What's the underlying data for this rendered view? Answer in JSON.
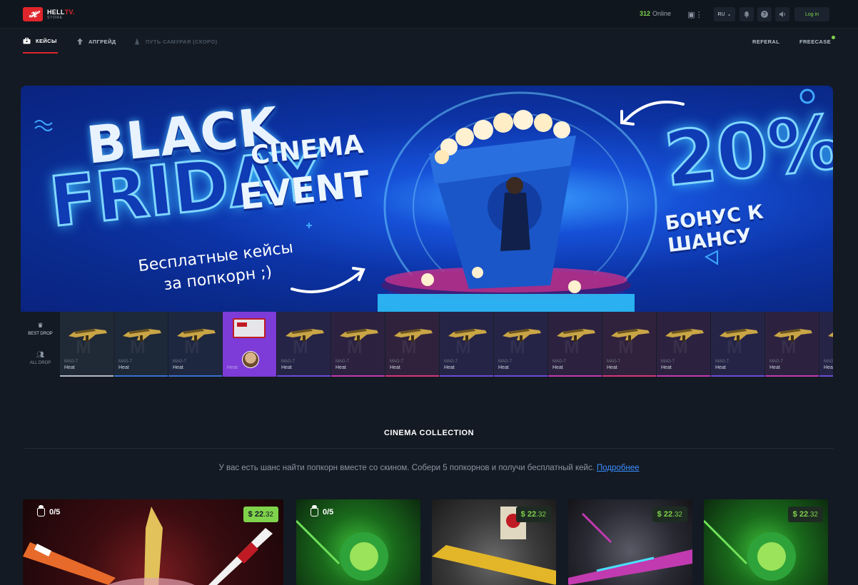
{
  "header": {
    "logo_mark": "𝓗",
    "logo_main_a": "HELL",
    "logo_main_b": "TV.",
    "logo_sub": "STORE",
    "online_count": "312",
    "online_label": "Online",
    "lang": "RU",
    "login_label": "Log in"
  },
  "nav": {
    "cases": "КЕЙСЫ",
    "upgrade": "АПГРЕЙД",
    "samurai": "ПУТЬ САМУРАЯ (СКОРО)",
    "referal": "REFERAL",
    "freecase": "FREECASE"
  },
  "banner": {
    "black": "BLACK",
    "friday": "FRIDAY",
    "cinema": "CINEMA",
    "event": "EVENT",
    "free_line1": "Бесплатные кейсы",
    "free_line2": "за попкорн ;)",
    "percent": "20%",
    "bonus": "БОНУС К ШАНСУ"
  },
  "drops": {
    "best_label": "BEST DROP",
    "all_label": "ALL DROP",
    "items": [
      {
        "name": "MAG-7",
        "skin": "Heat",
        "color": "#b4b8c0",
        "bg": "#202a36"
      },
      {
        "name": "MAG-7",
        "skin": "Heat",
        "color": "#3b6fd0",
        "bg": "#1d2838"
      },
      {
        "name": "MAG-7",
        "skin": "Heat",
        "color": "#3b6fd0",
        "bg": "#1e2740"
      },
      {
        "name": "",
        "skin": "Heat",
        "color": "#7d3bd8",
        "bg": "#7d3bd8"
      },
      {
        "name": "MAG-7",
        "skin": "Heat",
        "color": "#6b4cd8",
        "bg": "#262446"
      },
      {
        "name": "MAG-7",
        "skin": "Heat",
        "color": "#c23ab0",
        "bg": "#2c2240"
      },
      {
        "name": "MAG-7",
        "skin": "Heat",
        "color": "#d8357a",
        "bg": "#30223c"
      },
      {
        "name": "MAG-7",
        "skin": "Heat",
        "color": "#6b4cd8",
        "bg": "#262446"
      },
      {
        "name": "MAG-7",
        "skin": "Heat",
        "color": "#6b4cd8",
        "bg": "#262446"
      },
      {
        "name": "MAG-7",
        "skin": "Heat",
        "color": "#c23ab0",
        "bg": "#2c2240"
      },
      {
        "name": "MAG-7",
        "skin": "Heat",
        "color": "#d8357a",
        "bg": "#30223c"
      },
      {
        "name": "MAG-7",
        "skin": "Heat",
        "color": "#c23ab0",
        "bg": "#2c2240"
      },
      {
        "name": "MAG-7",
        "skin": "Heat",
        "color": "#6b4cd8",
        "bg": "#262446"
      },
      {
        "name": "MAG-7",
        "skin": "Heat",
        "color": "#c23ab0",
        "bg": "#2c2240"
      },
      {
        "name": "MAG-7",
        "skin": "Heat",
        "color": "#6b4cd8",
        "bg": "#262446"
      }
    ]
  },
  "collection": {
    "title": "CINEMA COLLECTION",
    "description": "У вас есть шанс найти попкорн вместе со скином. Собери 5 попкорнов и получи бесплатный кейс.",
    "more_link": "Подробнее",
    "cards": [
      {
        "counter": "0/5",
        "price_main": "$ 22",
        "price_cents": ".32"
      },
      {
        "counter": "0/5",
        "price_main": "$ 22",
        "price_cents": ".32"
      },
      {
        "counter": "",
        "price_main": "$ 22",
        "price_cents": ".32"
      },
      {
        "counter": "",
        "price_main": "$ 22",
        "price_cents": ".32"
      },
      {
        "counter": "",
        "price_main": "$ 22",
        "price_cents": ".32"
      }
    ]
  }
}
